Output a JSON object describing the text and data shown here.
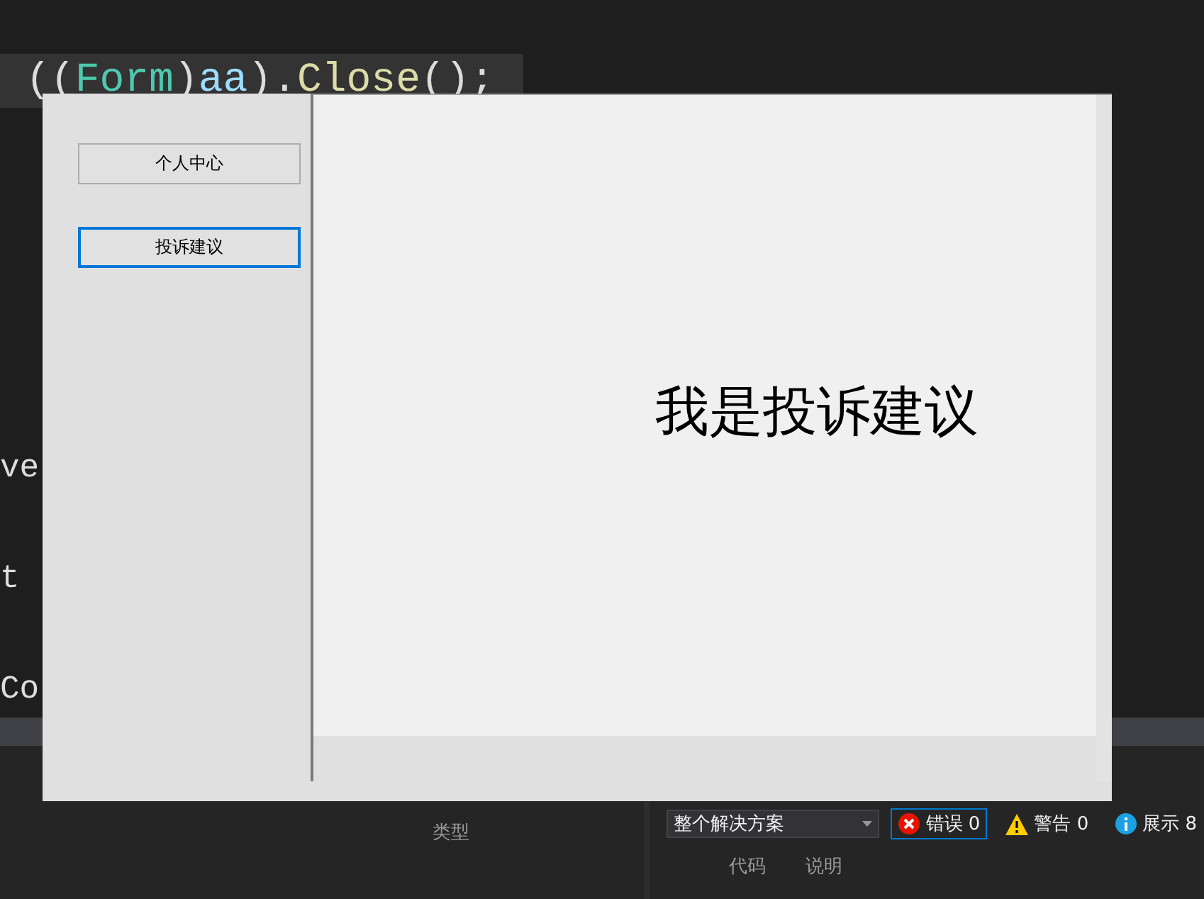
{
  "editor": {
    "lines": [
      {
        "tokens": [
          {
            "text": "((",
            "kind": "punct"
          },
          {
            "text": "Form",
            "kind": "type"
          },
          {
            "text": ")",
            "kind": "punct"
          },
          {
            "text": "aa",
            "kind": "var"
          },
          {
            "text": ").",
            "kind": "punct"
          },
          {
            "text": "Close",
            "kind": "method"
          },
          {
            "text": "();",
            "kind": "punct"
          }
        ],
        "highlighted": true
      },
      {
        "tokens": [
          {
            "text": "ve",
            "kind": "punct"
          }
        ],
        "highlighted": false
      },
      {
        "tokens": [
          {
            "text": "t",
            "kind": "punct"
          }
        ],
        "highlighted": false
      },
      {
        "tokens": [
          {
            "text": "Co",
            "kind": "punct"
          }
        ],
        "highlighted": false
      }
    ]
  },
  "form": {
    "nav_buttons": [
      {
        "label": "个人中心",
        "selected": false
      },
      {
        "label": "投诉建议",
        "selected": true
      }
    ],
    "content_label": "我是投诉建议"
  },
  "error_list": {
    "scope": "整个解决方案",
    "filters": [
      {
        "kind": "error",
        "label": "错误 0",
        "selected": true
      },
      {
        "kind": "warning",
        "label": "警告 0",
        "selected": false
      },
      {
        "kind": "info",
        "label": "展示 8",
        "selected": false
      }
    ],
    "columns": [
      "类型",
      "代码",
      "说明"
    ]
  }
}
